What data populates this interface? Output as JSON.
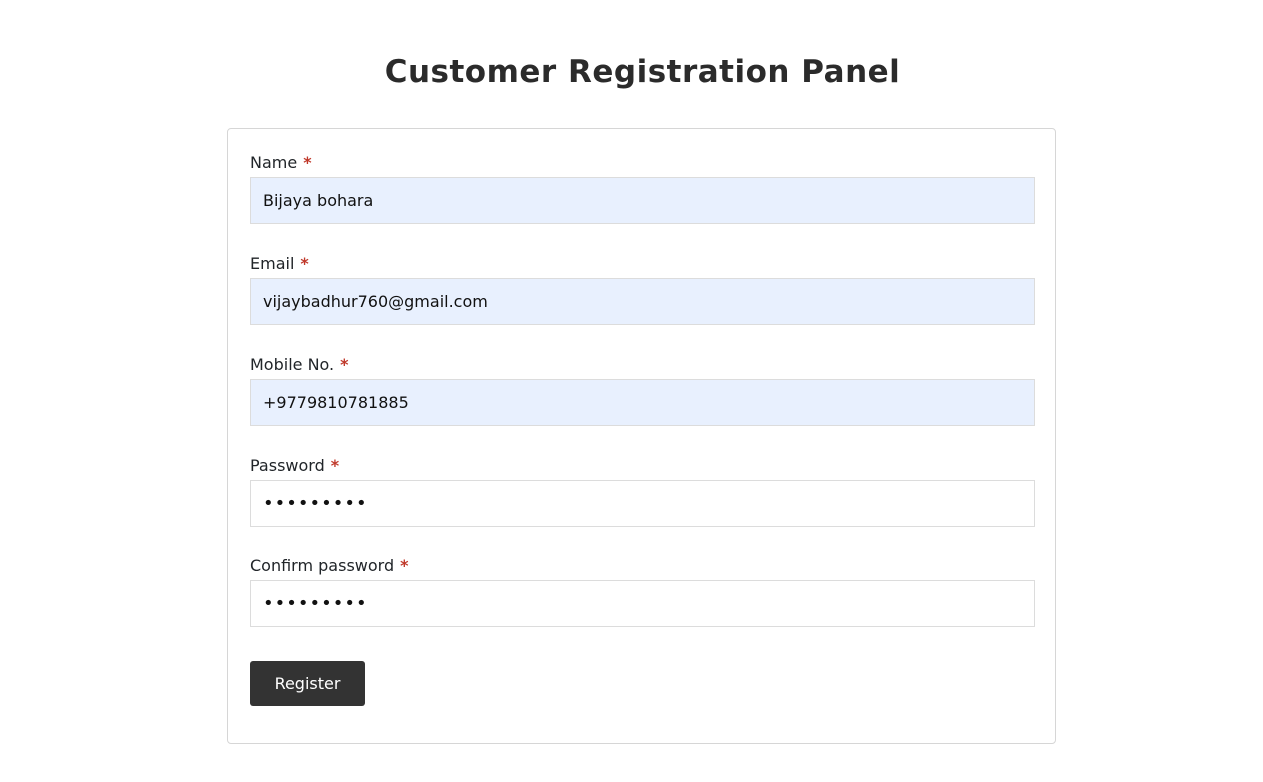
{
  "page": {
    "title": "Customer Registration Panel"
  },
  "form": {
    "required_mark": "*",
    "fields": [
      {
        "label": "Name",
        "value": "Bijaya bohara",
        "type": "text"
      },
      {
        "label": "Email",
        "value": "vijaybadhur760@gmail.com",
        "type": "email"
      },
      {
        "label": "Mobile No.",
        "value": "+9779810781885",
        "type": "tel"
      },
      {
        "label": "Password",
        "value": "•••••••••",
        "type": "password"
      },
      {
        "label": "Confirm password",
        "value": "•••••••••",
        "type": "password"
      }
    ],
    "submit_label": "Register"
  },
  "colors": {
    "autofill_background": "#e8f0fe",
    "required_mark": "#c0392b",
    "button_background": "#333333"
  }
}
